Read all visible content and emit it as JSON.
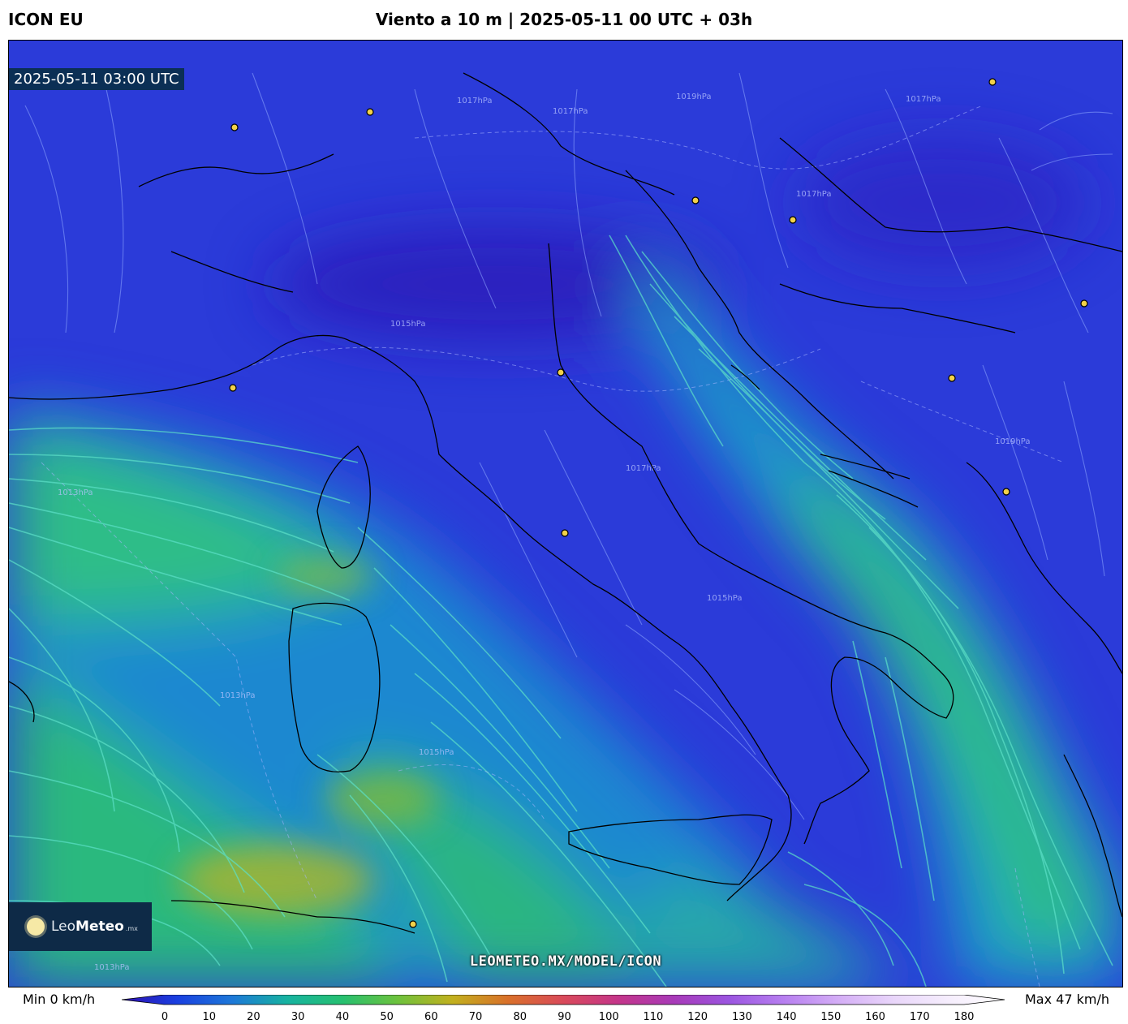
{
  "header": {
    "model": "ICON EU",
    "title": "Viento a 10 m | 2025-05-11 00 UTC + 03h"
  },
  "map": {
    "timestamp": "2025-05-11 03:00 UTC",
    "watermark": "LEOMETEO.MX/MODEL/ICON",
    "isobar_labels": [
      "1017hPa",
      "1019hPa",
      "1017hPa",
      "1017hPa",
      "1017hPa",
      "1015hPa",
      "1013hPa",
      "1013hPa",
      "1019hPa",
      "1017hPa",
      "1015hPa",
      "1015hPa",
      "1013hPa"
    ]
  },
  "logo": {
    "name_light": "Leo",
    "name_bold": "Meteo",
    "suffix": ".mx"
  },
  "legend": {
    "min_label": "Min 0 km/h",
    "max_label": "Max 47 km/h",
    "unit": "km/h",
    "ticks": [
      "0",
      "10",
      "20",
      "30",
      "40",
      "50",
      "60",
      "70",
      "80",
      "90",
      "100",
      "110",
      "120",
      "130",
      "140",
      "150",
      "160",
      "170",
      "180"
    ],
    "color_stops": [
      "#2e0fb0",
      "#1a3fe0",
      "#1d78d8",
      "#17b3a0",
      "#26c070",
      "#6dc23d",
      "#c2b01e",
      "#d9702a",
      "#d94a5a",
      "#c4358a",
      "#a83ab8",
      "#9b55e0",
      "#b77ff0",
      "#d4aef6",
      "#e9d6fa",
      "#f6eefd",
      "#ffffff"
    ]
  },
  "colors": {
    "calm": "#2a33d6",
    "moderate": "#1d8fd0",
    "strong": "#2ec27a",
    "max": "#a6b62a",
    "coastline": "#000000",
    "city_marker": "#f2d14a"
  }
}
